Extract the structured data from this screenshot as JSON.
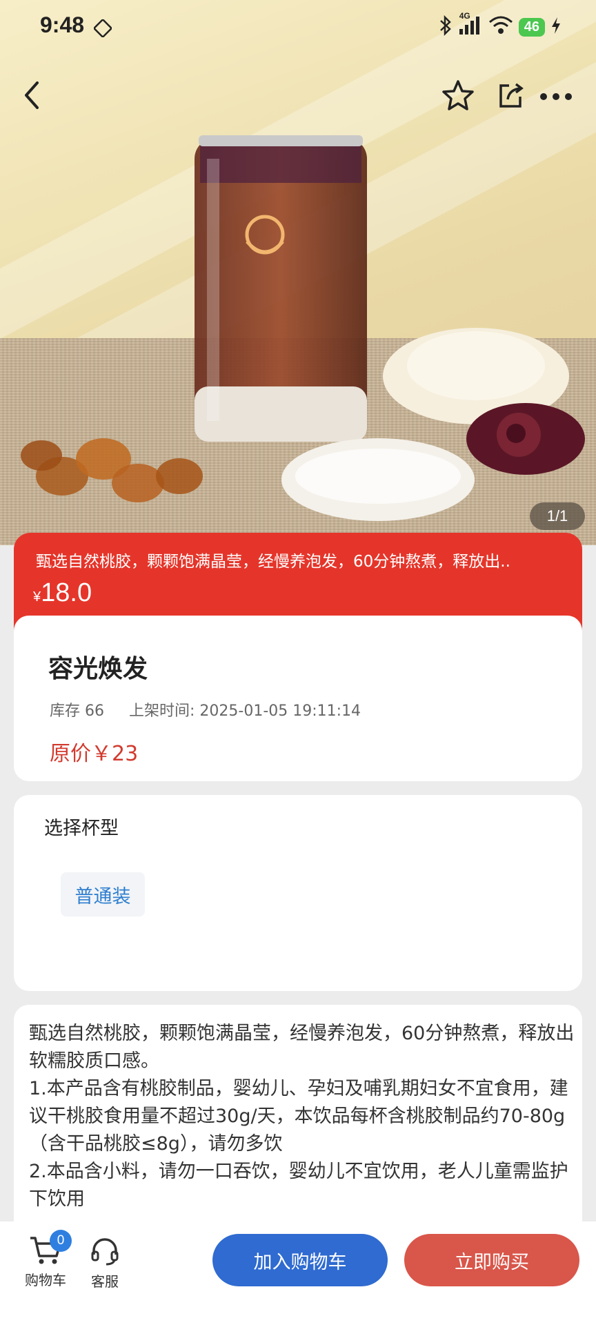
{
  "status_bar": {
    "time": "9:48",
    "network": "4G",
    "battery": "46"
  },
  "nav": {
    "back_icon": "chevron-left-icon",
    "favorite_icon": "star-icon",
    "share_icon": "share-icon",
    "more_icon": "more-icon"
  },
  "gallery": {
    "page_indicator": "1/1"
  },
  "promo": {
    "description": "甄选自然桃胶，颗颗饱满晶莹，经慢养泡发，60分钟熬煮，释放出..",
    "currency": "¥",
    "price": "18.0"
  },
  "product": {
    "name": "容光焕发",
    "stock": "库存 66",
    "listed_time": "上架时间: 2025-01-05 19:11:14",
    "original_price": "原价￥23"
  },
  "spec": {
    "title": "选择杯型",
    "option": "普通装"
  },
  "description": {
    "text": "甄选自然桃胶，颗颗饱满晶莹，经慢养泡发，60分钟熬煮，释放出软糯胶质口感。\n1.本产品含有桃胶制品，婴幼儿、孕妇及哺乳期妇女不宜食用，建议干桃胶食用量不超过30g/天，本饮品每杯含桃胶制品约70-80g（含干品桃胶≤8g），请勿多饮\n2.本品含小料，请勿一口吞饮，婴幼儿不宜饮用，老人儿童需监护下饮用"
  },
  "bottom_bar": {
    "cart_label": "购物车",
    "cart_count": "0",
    "service_label": "客服",
    "add_to_cart": "加入购物车",
    "buy_now": "立即购买"
  },
  "colors": {
    "accent_red": "#e5352a",
    "blue": "#2f6bd0",
    "buy_red": "#d9564a"
  }
}
